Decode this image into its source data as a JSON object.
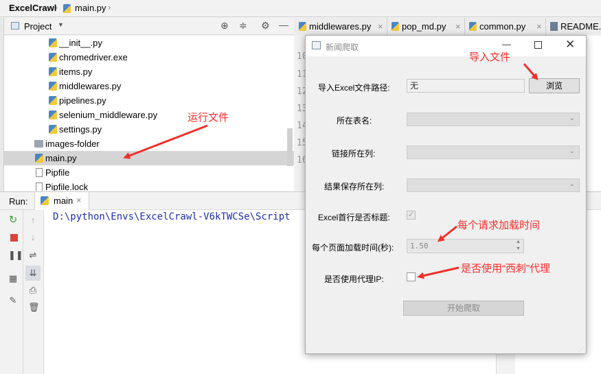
{
  "breadcrumb": {
    "project": "ExcelCrawl",
    "file": "main.py"
  },
  "project_panel": {
    "title": "Project",
    "tree": [
      {
        "label": "__init__.py",
        "kind": "py"
      },
      {
        "label": "chromedriver.exe",
        "kind": "py"
      },
      {
        "label": "items.py",
        "kind": "py"
      },
      {
        "label": "middlewares.py",
        "kind": "py"
      },
      {
        "label": "pipelines.py",
        "kind": "py"
      },
      {
        "label": "selenium_middleware.py",
        "kind": "py"
      },
      {
        "label": "settings.py",
        "kind": "py"
      },
      {
        "label": "images-folder",
        "kind": "folder"
      },
      {
        "label": "main.py",
        "kind": "py",
        "selected": true
      },
      {
        "label": "Pipfile",
        "kind": "file"
      },
      {
        "label": "Pipfile.lock",
        "kind": "file"
      }
    ]
  },
  "editor": {
    "tabs": [
      "middlewares.py",
      "pop_md.py",
      "common.py",
      "README.m"
    ],
    "line_numbers": [
      "10",
      "11",
      "12",
      "13",
      "14",
      "15",
      "16"
    ]
  },
  "run_panel": {
    "label": "Run:",
    "tab": "main",
    "console_line": "D:\\python\\Envs\\ExcelCrawl-V6kTWCSe\\Script"
  },
  "dialog": {
    "title": "新闻爬取",
    "excel_path_label": "导入Excel文件路径:",
    "excel_path_value": "无",
    "browse_button": "浏览",
    "sheet_label": "所在表名:",
    "link_col_label": "链接所在列:",
    "result_col_label": "结果保存所在列:",
    "header_label": "Excel首行是否标题:",
    "load_time_label": "每个页面加载时间(秒):",
    "load_time_value": "1.50",
    "proxy_label": "是否使用代理IP:",
    "start_button": "开始爬取"
  },
  "annotations": {
    "run_file": "运行文件",
    "import_file": "导入文件",
    "load_time": "每个请求加载时间",
    "proxy": "是否使用“西刺”代理"
  },
  "colors": {
    "annotation": "#f0302a",
    "console_text": "#1f2fa8"
  }
}
